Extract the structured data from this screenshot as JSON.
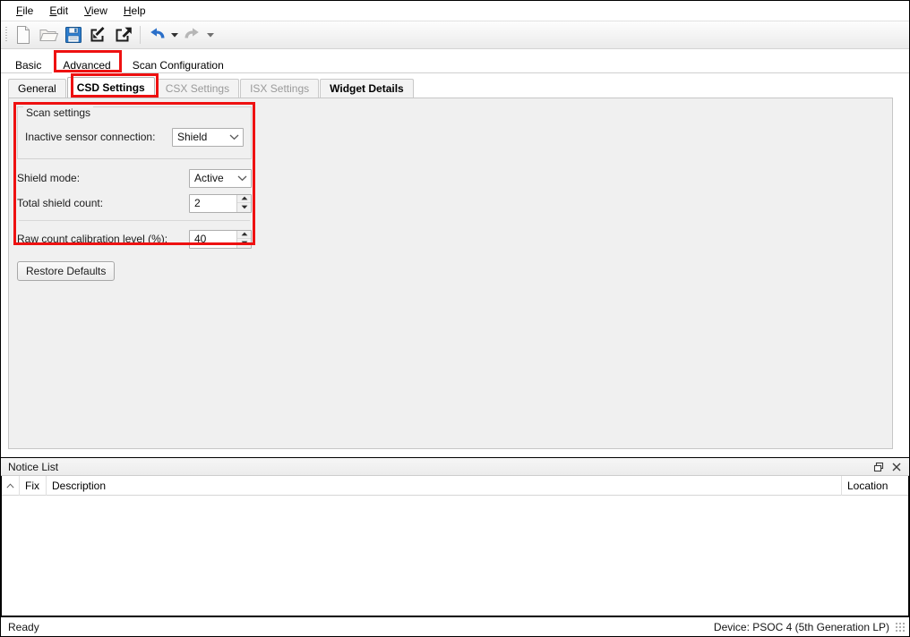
{
  "menu": {
    "items": [
      {
        "label": "File",
        "mnemonic": "F"
      },
      {
        "label": "Edit",
        "mnemonic": "E"
      },
      {
        "label": "View",
        "mnemonic": "V"
      },
      {
        "label": "Help",
        "mnemonic": "H"
      }
    ]
  },
  "toolbar": {
    "buttons": [
      {
        "name": "new-file-icon",
        "label": "New",
        "enabled": false
      },
      {
        "name": "open-folder-icon",
        "label": "Open",
        "enabled": false
      },
      {
        "name": "save-icon",
        "label": "Save",
        "enabled": true
      },
      {
        "name": "import-icon",
        "label": "Import",
        "enabled": true
      },
      {
        "name": "export-icon",
        "label": "Export",
        "enabled": true
      },
      {
        "name": "undo-icon",
        "label": "Undo",
        "enabled": true
      },
      {
        "name": "redo-icon",
        "label": "Redo",
        "enabled": false
      }
    ]
  },
  "outer_tabs": {
    "selected": "Advanced",
    "items": [
      {
        "label": "Basic",
        "selected": false,
        "highlighted": false
      },
      {
        "label": "Advanced",
        "selected": true,
        "highlighted": true
      },
      {
        "label": "Scan Configuration",
        "selected": false,
        "highlighted": false
      }
    ]
  },
  "inner_tabs": {
    "selected": "CSD Settings",
    "items": [
      {
        "label": "General",
        "selected": false,
        "enabled": true,
        "highlighted": false
      },
      {
        "label": "CSD Settings",
        "selected": true,
        "enabled": true,
        "highlighted": true
      },
      {
        "label": "CSX Settings",
        "selected": false,
        "enabled": false,
        "highlighted": false
      },
      {
        "label": "ISX Settings",
        "selected": false,
        "enabled": false,
        "highlighted": false
      },
      {
        "label": "Widget Details",
        "selected": false,
        "enabled": true,
        "highlighted": false
      }
    ]
  },
  "settings": {
    "group_title": "Scan settings",
    "inactive_sensor_connection": {
      "label": "Inactive sensor connection:",
      "value": "Shield"
    },
    "shield_mode": {
      "label": "Shield mode:",
      "value": "Active"
    },
    "total_shield_count": {
      "label": "Total shield count:",
      "value": "2"
    },
    "raw_count_calibration_level": {
      "label": "Raw count calibration level (%):",
      "value": "40"
    },
    "restore_defaults_label": "Restore Defaults"
  },
  "notice_list": {
    "title": "Notice List",
    "float_button": "float-icon",
    "close_button": "close-icon",
    "columns": [
      {
        "key": "sort",
        "label": ""
      },
      {
        "key": "fix",
        "label": "Fix"
      },
      {
        "key": "description",
        "label": "Description"
      },
      {
        "key": "location",
        "label": "Location"
      }
    ],
    "rows": []
  },
  "status_bar": {
    "left": "Ready",
    "right": "Device: PSOC 4 (5th Generation LP)"
  },
  "colors": {
    "annotation_red": "#ee1111",
    "accent_blue": "#1f6fc4",
    "disabled_gray": "#9a9a9a",
    "panel_bg": "#f0f0f0"
  }
}
